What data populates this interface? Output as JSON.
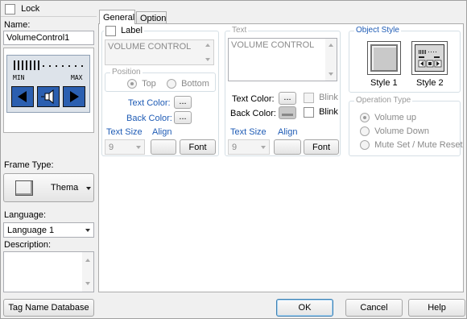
{
  "left": {
    "lock_label": "Lock",
    "name_label": "Name:",
    "name_value": "VolumeControl1",
    "preview": {
      "min_label": "MIN",
      "max_label": "MAX"
    },
    "frame_type_label": "Frame Type:",
    "frame_type_value": "Thema",
    "language_label": "Language:",
    "language_value": "Language 1",
    "description_label": "Description:"
  },
  "tabs": [
    {
      "label": "General"
    },
    {
      "label": "Option"
    }
  ],
  "label_group": {
    "label_checkbox": "Label",
    "label_text": "VOLUME CONTROL",
    "position_title": "Position",
    "position_top": "Top",
    "position_bottom": "Bottom",
    "text_color_label": "Text Color:",
    "back_color_label": "Back Color:",
    "color_button": "...",
    "text_size_label": "Text Size",
    "align_label": "Align",
    "text_size_value": "9",
    "font_button": "Font"
  },
  "text_group": {
    "title": "Text",
    "text_value": "VOLUME CONTROL",
    "text_color_label": "Text Color:",
    "back_color_label": "Back Color:",
    "color_button": "...",
    "blink_label": "Blink",
    "text_size_label": "Text Size",
    "align_label": "Align",
    "text_size_value": "9",
    "font_button": "Font"
  },
  "object_style": {
    "title": "Object Style",
    "style1_label": "Style 1",
    "style2_label": "Style 2"
  },
  "operation_type": {
    "title": "Operation Type",
    "options": [
      "Volume up",
      "Volume Down",
      "Mute Set / Mute Reset"
    ]
  },
  "bottom": {
    "tag_button": "Tag Name Database",
    "ok_button": "OK",
    "cancel_button": "Cancel",
    "help_button": "Help"
  },
  "colors": {
    "accent_blue": "#1e5bb5",
    "preview_blue": "#2b5fb0"
  }
}
